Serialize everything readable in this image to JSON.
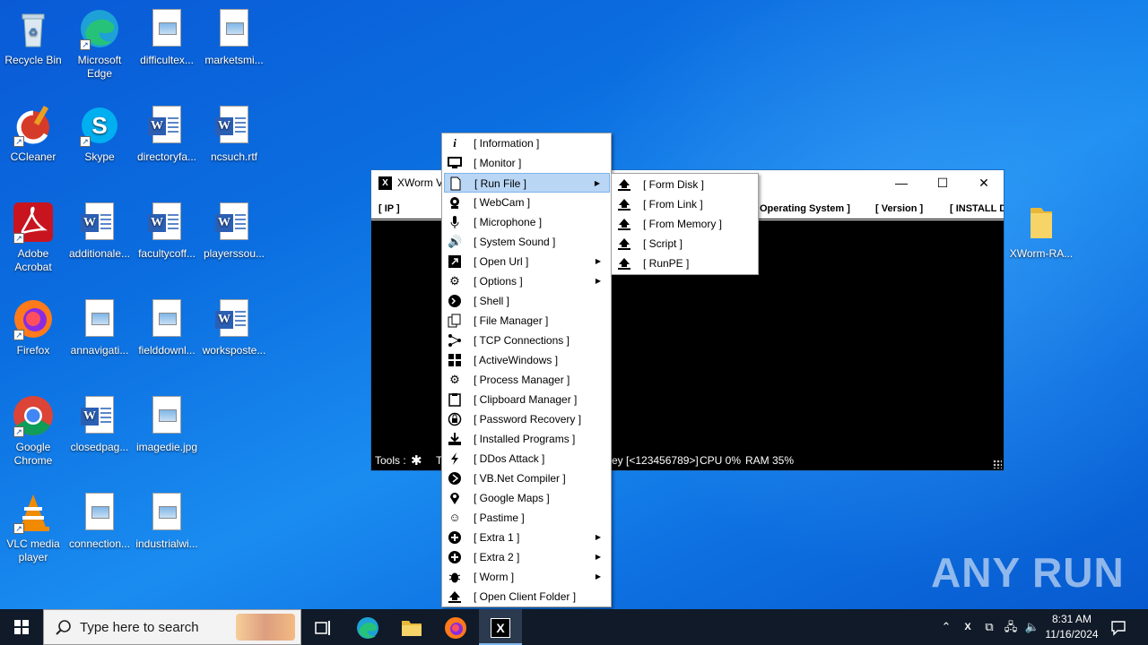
{
  "desktop_icons": [
    {
      "label": "Recycle Bin",
      "icon": "recycle-bin-icon"
    },
    {
      "label": "Microsoft Edge",
      "icon": "edge-icon"
    },
    {
      "label": "difficultex...",
      "icon": "image-file-icon"
    },
    {
      "label": "marketsmi...",
      "icon": "image-file-icon"
    },
    {
      "label": "CCleaner",
      "icon": "ccleaner-icon"
    },
    {
      "label": "Skype",
      "icon": "skype-icon"
    },
    {
      "label": "directoryfa...",
      "icon": "word-doc-icon"
    },
    {
      "label": "ncsuch.rtf",
      "icon": "word-doc-icon"
    },
    {
      "label": "Adobe Acrobat",
      "icon": "acrobat-icon"
    },
    {
      "label": "additionale...",
      "icon": "word-doc-icon"
    },
    {
      "label": "facultycoff...",
      "icon": "word-doc-icon"
    },
    {
      "label": "playerssou...",
      "icon": "word-doc-icon"
    },
    {
      "label": "Firefox",
      "icon": "firefox-icon"
    },
    {
      "label": "annavigati...",
      "icon": "image-file-icon"
    },
    {
      "label": "fielddownl...",
      "icon": "image-file-icon"
    },
    {
      "label": "workspostе...",
      "icon": "word-doc-icon"
    },
    {
      "label": "Google Chrome",
      "icon": "chrome-icon"
    },
    {
      "label": "closedpag...",
      "icon": "word-doc-icon"
    },
    {
      "label": "imagedie.jpg",
      "icon": "image-file-icon"
    },
    {
      "label": "VLC media player",
      "icon": "vlc-icon"
    },
    {
      "label": "connection...",
      "icon": "image-file-icon"
    },
    {
      "label": "industrialwi...",
      "icon": "image-file-icon"
    },
    {
      "label": "XWorm-RA...",
      "icon": "folder-icon"
    }
  ],
  "xworm_window": {
    "title": "XWorm V",
    "columns": [
      "[ IP ]",
      "Operating System ]",
      "[ Version ]",
      "[ INSTALL D"
    ],
    "status": {
      "tools_label": "Tools :",
      "t_label": "T",
      "key_text": "ey [<123456789>]",
      "cpu": "CPU 0%",
      "ram": "RAM 35%"
    },
    "controls": {
      "minimize": "—",
      "maximize": "☐",
      "close": "✕"
    }
  },
  "context_menu": {
    "items": [
      {
        "label": "[ Information ]",
        "icon": "info-icon",
        "submenu": false
      },
      {
        "label": "[ Monitor ]",
        "icon": "monitor-icon",
        "submenu": false
      },
      {
        "label": "[ Run File ]",
        "icon": "file-icon",
        "submenu": true,
        "highlighted": true
      },
      {
        "label": "[ WebCam ]",
        "icon": "webcam-icon",
        "submenu": false
      },
      {
        "label": "[ Microphone ]",
        "icon": "microphone-icon",
        "submenu": false
      },
      {
        "label": "[ System Sound ]",
        "icon": "speaker-icon",
        "submenu": false
      },
      {
        "label": "[ Open Url ]",
        "icon": "open-url-icon",
        "submenu": true
      },
      {
        "label": "[ Options ]",
        "icon": "gear-icon",
        "submenu": true
      },
      {
        "label": "[ Shell ]",
        "icon": "shell-icon",
        "submenu": false
      },
      {
        "label": "[ File Manager ]",
        "icon": "file-manager-icon",
        "submenu": false
      },
      {
        "label": "[ TCP Connections ]",
        "icon": "network-icon",
        "submenu": false
      },
      {
        "label": "[ ActiveWindows ]",
        "icon": "windows-icon",
        "submenu": false
      },
      {
        "label": "[ Process Manager ]",
        "icon": "process-icon",
        "submenu": false
      },
      {
        "label": "[ Clipboard Manager ]",
        "icon": "clipboard-icon",
        "submenu": false
      },
      {
        "label": "[ Password Recovery ]",
        "icon": "password-icon",
        "submenu": false
      },
      {
        "label": "[ Installed Programs ]",
        "icon": "download-icon",
        "submenu": false
      },
      {
        "label": "[ DDos Attack ]",
        "icon": "bolt-icon",
        "submenu": false
      },
      {
        "label": "[ VB.Net Compiler ]",
        "icon": "compiler-icon",
        "submenu": false
      },
      {
        "label": "[ Google Maps ]",
        "icon": "map-pin-icon",
        "submenu": false
      },
      {
        "label": "[ Pastime ]",
        "icon": "smiley-icon",
        "submenu": false
      },
      {
        "label": "[ Extra 1 ]",
        "icon": "plus-circle-icon",
        "submenu": true
      },
      {
        "label": "[ Extra 2 ]",
        "icon": "plus-circle-icon",
        "submenu": true
      },
      {
        "label": "[ Worm ]",
        "icon": "bug-icon",
        "submenu": true
      },
      {
        "label": "[ Open Client Folder ]",
        "icon": "upload-icon",
        "submenu": false
      }
    ]
  },
  "submenu": {
    "items": [
      {
        "label": "[ Form Disk ]"
      },
      {
        "label": "[ From Link ]"
      },
      {
        "label": "[ From Memory ]"
      },
      {
        "label": "[ Script ]"
      },
      {
        "label": "[ RunPE ]"
      }
    ]
  },
  "watermark": "ANY RUN",
  "taskbar": {
    "search_placeholder": "Type here to search",
    "time": "8:31 AM",
    "date": "11/16/2024"
  }
}
